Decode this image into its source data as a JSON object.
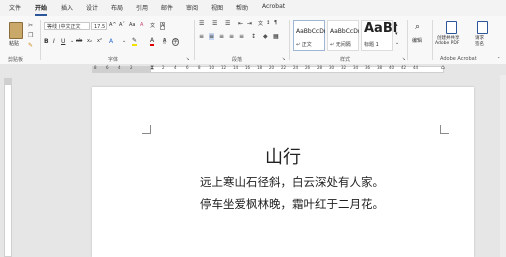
{
  "tabs": [
    "文件",
    "开始",
    "插入",
    "设计",
    "布局",
    "引用",
    "邮件",
    "审阅",
    "视图",
    "帮助",
    "Acrobat"
  ],
  "clipboard": {
    "paste": "粘贴",
    "group": "剪贴板"
  },
  "font": {
    "name": "等线 (中文正文",
    "size": "17.5",
    "group": "字体"
  },
  "paragraph": {
    "group": "段落"
  },
  "styles": {
    "group": "样式",
    "items": [
      {
        "preview": "AaBbCcDı",
        "name": "↵ 正文"
      },
      {
        "preview": "AaBbCcDı",
        "name": "↵ 无间隔"
      },
      {
        "preview": "AaBl",
        "name": "标题 1"
      }
    ]
  },
  "editing": {
    "label": "编辑"
  },
  "acrobat": {
    "create_share": "创建并共享",
    "adobe_pdf": "Adobe PDF",
    "request": "请求",
    "sign": "签名",
    "group": "Adobe Acrobat"
  },
  "ruler": [
    "8",
    "6",
    "4",
    "2",
    "",
    "2",
    "4",
    "6",
    "8",
    "10",
    "12",
    "14",
    "16",
    "18",
    "20",
    "22",
    "24",
    "26",
    "28",
    "30",
    "32",
    "34",
    "36",
    "38",
    "40",
    "42",
    "44",
    "46"
  ],
  "document": {
    "title": "山行",
    "lines": [
      "远上寒山石径斜，白云深处有人家。",
      "停车坐爱枫林晚，霜叶红于二月花。"
    ]
  }
}
